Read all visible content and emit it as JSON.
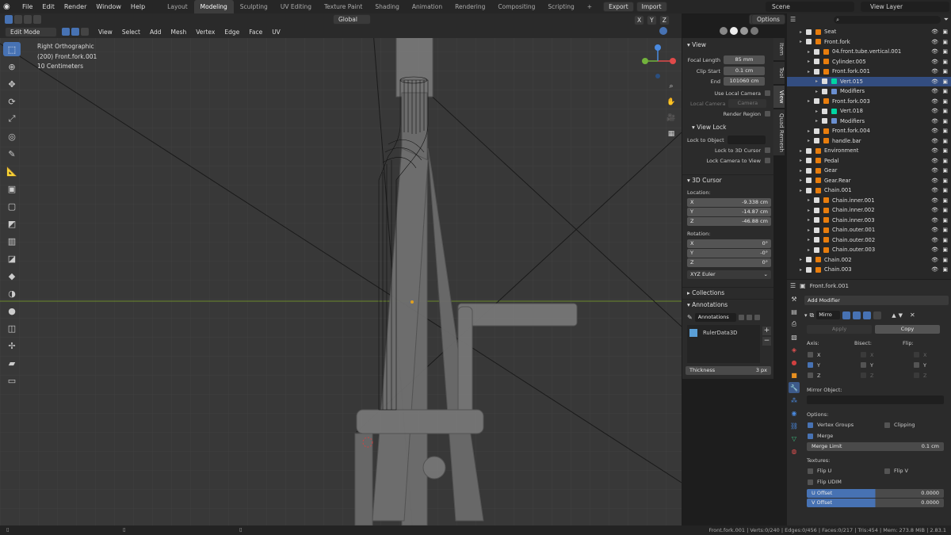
{
  "app": {
    "menus": [
      "File",
      "Edit",
      "Render",
      "Window",
      "Help"
    ],
    "workspaces": [
      "Layout",
      "Modeling",
      "Sculpting",
      "UV Editing",
      "Texture Paint",
      "Shading",
      "Animation",
      "Rendering",
      "Compositing",
      "Scripting"
    ],
    "active_workspace": "Modeling",
    "plus": "+",
    "export_label": "Export",
    "import_label": "Import",
    "scene": "Scene",
    "view_layer": "View Layer"
  },
  "viewport_header": {
    "orientation": "Global",
    "options_label": "Options",
    "mode": "Edit Mode",
    "menus": [
      "View",
      "Select",
      "Add",
      "Mesh",
      "Vertex",
      "Edge",
      "Face",
      "UV"
    ]
  },
  "overlay": {
    "view_name": "Right Orthographic",
    "object_name": "(200) Front.fork.001",
    "scale": "10 Centimeters"
  },
  "gizmo": {
    "x": "X",
    "y": "Y",
    "z": "Z"
  },
  "npanel": {
    "view_title": "View",
    "focal_length_label": "Focal Length",
    "focal_length": "85 mm",
    "clip_start_label": "Clip Start",
    "clip_start": "0.1 cm",
    "end_label": "End",
    "clip_end": "101060 cm",
    "use_local_camera": "Use Local Camera",
    "local_camera": "Local Camera",
    "camera": "Camera",
    "render_region": "Render Region",
    "view_lock_title": "View Lock",
    "lock_to_object": "Lock to Object",
    "lock_3d_cursor": "Lock to 3D Cursor",
    "lock_camera": "Lock Camera to View",
    "cursor_title": "3D Cursor",
    "location_label": "Location:",
    "loc_x_label": "X",
    "loc_x": "-9.338 cm",
    "loc_y_label": "Y",
    "loc_y": "-14.87 cm",
    "loc_z_label": "Z",
    "loc_z": "-46.88 cm",
    "rotation_label": "Rotation:",
    "rot_x_label": "X",
    "rot_x": "0°",
    "rot_y_label": "Y",
    "rot_y": "-0°",
    "rot_z_label": "Z",
    "rot_z": "0°",
    "rotation_mode": "XYZ Euler",
    "collections_title": "Collections",
    "annotations_title": "Annotations",
    "annotations_name": "Annotations",
    "layer_name": "RulerData3D",
    "thickness_label": "Thickness",
    "thickness": "3 px"
  },
  "side_tabs": [
    "Item",
    "Tool",
    "View",
    "Quad Remesh"
  ],
  "outliner": {
    "rows": [
      {
        "name": "Seat",
        "indent": 1,
        "color": "#e87d0d"
      },
      {
        "name": "Front.fork",
        "indent": 1,
        "color": "#e87d0d"
      },
      {
        "name": "04.front.tube.vertical.001",
        "indent": 2,
        "color": "#e87d0d"
      },
      {
        "name": "Cylinder.005",
        "indent": 2,
        "color": "#e87d0d"
      },
      {
        "name": "Front.fork.001",
        "indent": 2,
        "color": "#e87d0d"
      },
      {
        "name": "Vert.015",
        "indent": 3,
        "color": "#00d4a3"
      },
      {
        "name": "Modifiers",
        "indent": 3,
        "color": "#6a8fd0"
      },
      {
        "name": "Front.fork.003",
        "indent": 2,
        "color": "#e87d0d"
      },
      {
        "name": "Vert.018",
        "indent": 3,
        "color": "#00d4a3"
      },
      {
        "name": "Modifiers",
        "indent": 3,
        "color": "#6a8fd0"
      },
      {
        "name": "Front.fork.004",
        "indent": 2,
        "color": "#e87d0d"
      },
      {
        "name": "handle.bar",
        "indent": 2,
        "color": "#e87d0d"
      },
      {
        "name": "Environment",
        "indent": 1,
        "color": "#e87d0d"
      },
      {
        "name": "Pedal",
        "indent": 1,
        "color": "#e87d0d"
      },
      {
        "name": "Gear",
        "indent": 1,
        "color": "#e87d0d"
      },
      {
        "name": "Gear.Rear",
        "indent": 1,
        "color": "#e87d0d"
      },
      {
        "name": "Chain.001",
        "indent": 1,
        "color": "#e87d0d"
      },
      {
        "name": "Chain.inner.001",
        "indent": 2,
        "color": "#e87d0d"
      },
      {
        "name": "Chain.inner.002",
        "indent": 2,
        "color": "#e87d0d"
      },
      {
        "name": "Chain.inner.003",
        "indent": 2,
        "color": "#e87d0d"
      },
      {
        "name": "Chain.outer.001",
        "indent": 2,
        "color": "#e87d0d"
      },
      {
        "name": "Chain.outer.002",
        "indent": 2,
        "color": "#e87d0d"
      },
      {
        "name": "Chain.outer.003",
        "indent": 2,
        "color": "#e87d0d"
      },
      {
        "name": "Chain.002",
        "indent": 1,
        "color": "#e87d0d"
      },
      {
        "name": "Chain.003",
        "indent": 1,
        "color": "#e87d0d"
      }
    ],
    "selected_index": 5
  },
  "properties": {
    "object_name": "Front.fork.001",
    "add_modifier": "Add Modifier",
    "modifier_name": "Mirro",
    "apply_label": "Apply",
    "copy_label": "Copy",
    "axis_label": "Axis:",
    "bisect_label": "Bisect:",
    "flip_label": "Flip:",
    "x": "X",
    "y": "Y",
    "z": "Z",
    "mirror_object_label": "Mirror Object:",
    "options_label": "Options:",
    "vertex_groups": "Vertex Groups",
    "clipping": "Clipping",
    "merge": "Merge",
    "merge_limit_label": "Merge Limit",
    "merge_limit": "0.1 cm",
    "textures_label": "Textures:",
    "flip_u": "Flip U",
    "flip_v": "Flip V",
    "flip_udim": "Flip UDIM",
    "u_offset_label": "U Offset",
    "u_offset": "0.0000",
    "v_offset_label": "V Offset",
    "v_offset": "0.0000"
  },
  "status": {
    "text": "Front.fork.001 | Verts:0/240 | Edges:0/456 | Faces:0/217 | Tris:454 | Mem: 273.8 MiB | 2.83.1"
  },
  "colors": {
    "accent": "#4772b3",
    "bg": "#1d1d1d",
    "grid": "#2f2f2f",
    "horizon": "#6d8a2c"
  }
}
